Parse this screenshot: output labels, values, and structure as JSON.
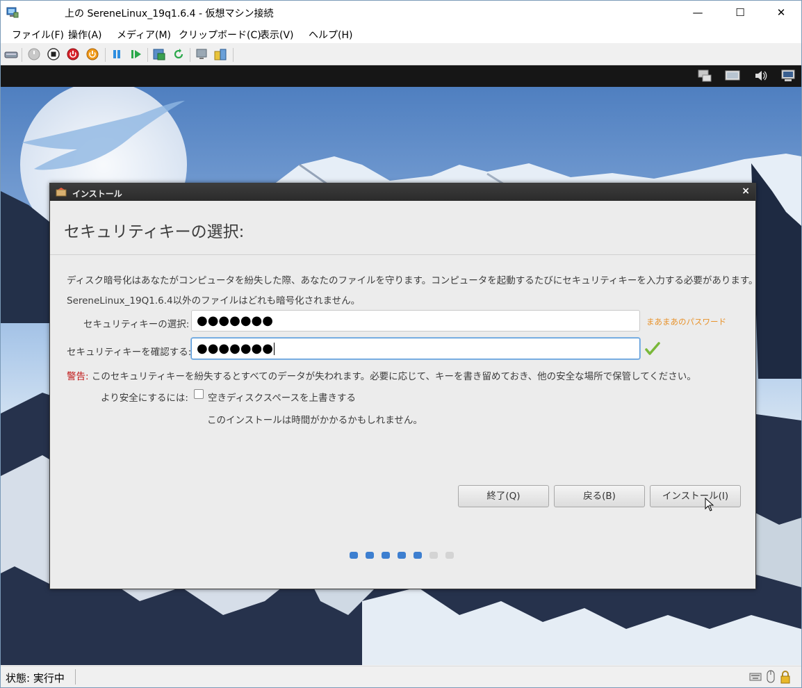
{
  "window": {
    "title": "上の SereneLinux_19q1.6.4  - 仮想マシン接続",
    "minimize_glyph": "—",
    "maximize_glyph": "☐",
    "close_glyph": "✕"
  },
  "menubar": {
    "items": [
      "ファイル(F)",
      "操作(A)",
      "メディア(M)",
      "クリップボード(C)",
      "表示(V)",
      "ヘルプ(H)"
    ]
  },
  "toolbar": {
    "icons": [
      "ctrl-alt-del-icon",
      "start-icon",
      "turn-off-icon",
      "shutdown-icon",
      "save-state-icon",
      "pause-icon",
      "resume-icon",
      "checkpoint-icon",
      "revert-icon",
      "enhanced-session-icon",
      "share-icon"
    ]
  },
  "installer": {
    "title": "インストール",
    "close_glyph": "×",
    "heading": "セキュリティキーの選択:",
    "description_line1": "ディスク暗号化はあなたがコンピュータを紛失した際、あなたのファイルを守ります。コンピュータを起動するたびにセキュリティキーを入力する必要があります。",
    "description_line2": "SereneLinux_19Q1.6.4以外のファイルはどれも暗号化されません。",
    "key_label": "セキュリティキーの選択:",
    "key_value": "●●●●●●●",
    "strength_text": "まあまあのパスワード",
    "confirm_label": "セキュリティキーを確認する:",
    "confirm_value": "●●●●●●●",
    "warning_prefix": "警告:",
    "warning_text": " このセキュリティキーを紛失するとすべてのデータが失われます。必要に応じて、キーを書き留めておき、他の安全な場所で保管してください。",
    "safer_label": "より安全にするには:",
    "overwrite_label": "空きディスクスペースを上書きする",
    "overwrite_checked": false,
    "overwrite_note": "このインストールは時間がかかるかもしれません。",
    "buttons": {
      "quit": "終了(Q)",
      "back": "戻る(B)",
      "install": "インストール(I)"
    },
    "progress": {
      "completed_steps": 5,
      "total_steps": 7
    },
    "colors": {
      "step_done": "#3d7fd0",
      "step_todo": "#d4d4d4",
      "strength": "#e8922a",
      "warning": "#c01818"
    }
  },
  "statusbar": {
    "status": "状態: 実行中"
  }
}
